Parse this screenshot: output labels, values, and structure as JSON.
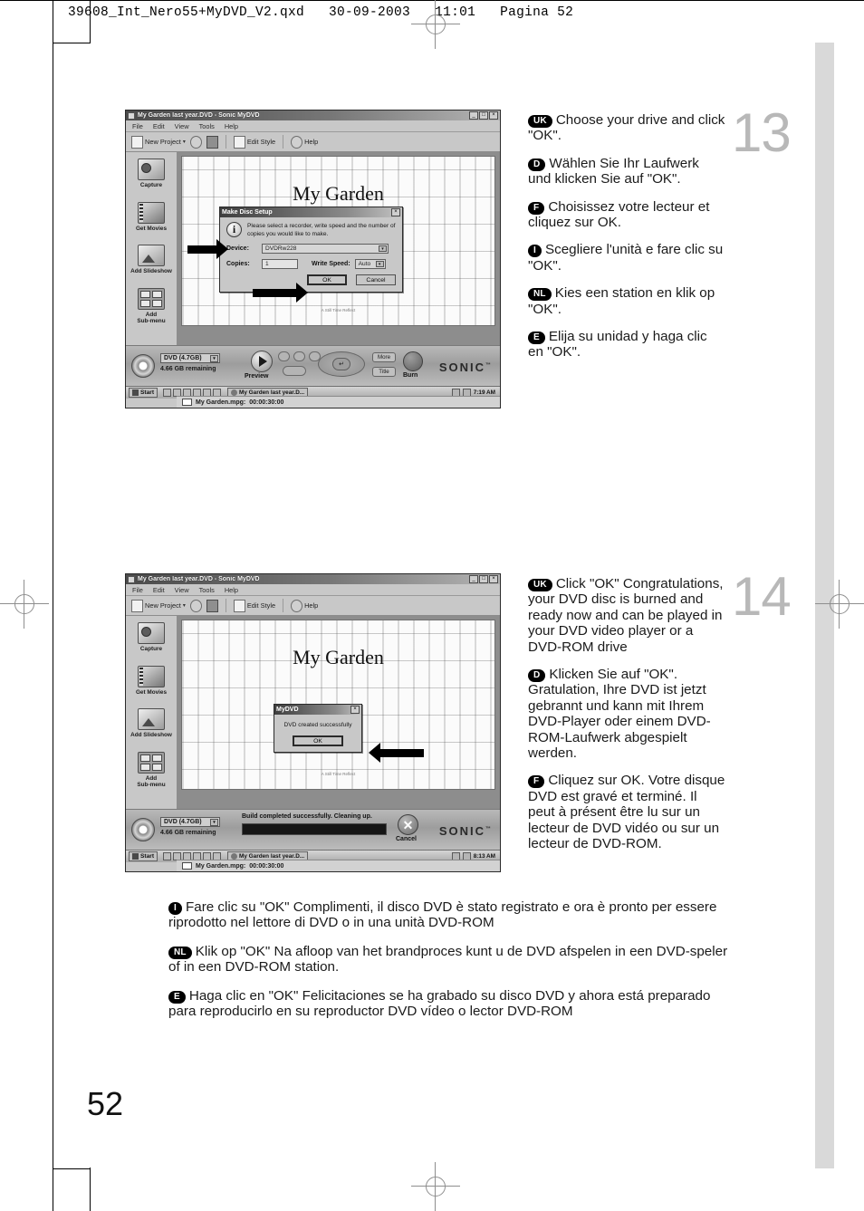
{
  "page": {
    "qxd_header": "39608_Int_Nero55+MyDVD_V2.qxd   30-09-2003   11:01   Pagina 52",
    "page_number": "52"
  },
  "steps": [
    {
      "number": "13"
    },
    {
      "number": "14"
    }
  ],
  "app": {
    "title": "My Garden last year.DVD - Sonic MyDVD",
    "menus": [
      "File",
      "Edit",
      "View",
      "Tools",
      "Help"
    ],
    "toolbar": {
      "new_project": "New Project",
      "caret": "▾",
      "edit_style": "Edit Style",
      "help": "Help"
    },
    "window_buttons": {
      "minimize": "_",
      "maximize": "□",
      "close": "×"
    },
    "sidebar": [
      {
        "label": "Capture",
        "icon": "camcorder-icon"
      },
      {
        "label": "Get Movies",
        "icon": "film-reel-icon"
      },
      {
        "label": "Add Slideshow",
        "icon": "picture-icon"
      },
      {
        "label": "Add\nSub-menu",
        "label_line1": "Add",
        "label_line2": "Sub-menu",
        "icon": "grid-icon"
      }
    ],
    "menu_page": {
      "title": "My Garden",
      "footnote": "A Still Time Reflect"
    },
    "file_bar": {
      "name": "My Garden.mpg:",
      "duration": "00:00:30:00"
    },
    "console": {
      "disc_type": "DVD (4.7GB)",
      "remaining": "4.66 GB remaining",
      "preview": "Preview",
      "more": "More",
      "title_btn": "Title",
      "burn": "Burn",
      "brand": "SONIC",
      "brand_tm": "™",
      "mini_buttons": [
        "❙❙",
        "⏮",
        "⏭"
      ],
      "dpad_enter": "↵"
    },
    "console_build": {
      "status": "Build completed successfully. Cleaning up.",
      "cancel": "Cancel",
      "cancel_glyph": "✕"
    },
    "taskbar": {
      "start": "Start",
      "task": "My Garden last year.D...",
      "time_step13": "7:19 AM",
      "time_step14": "8:13 AM"
    }
  },
  "dialog_setup": {
    "title": "Make Disc Setup",
    "close": "×",
    "message": "Please select a recorder, write speed and the number of copies you would like to make.",
    "info_glyph": "i",
    "device_label": "Device:",
    "device_value": "DVDRw228",
    "copies_label": "Copies:",
    "copies_value": "1",
    "write_speed_label": "Write Speed:",
    "write_speed_value": "Auto",
    "ok": "OK",
    "cancel": "Cancel",
    "dropdown_arrow": "▾"
  },
  "dialog_success": {
    "title": "MyDVD",
    "close": "×",
    "message": "DVD created successfully",
    "ok": "OK"
  },
  "instructions_13": [
    {
      "lang": "UK",
      "text": "Choose your drive and click \"OK\"."
    },
    {
      "lang": "D",
      "text": "Wählen Sie Ihr Laufwerk und klicken Sie auf \"OK\"."
    },
    {
      "lang": "F",
      "text": "Choisissez votre lecteur et cliquez sur OK."
    },
    {
      "lang": "I",
      "text": "Scegliere l'unità e fare clic su \"OK\"."
    },
    {
      "lang": "NL",
      "text": "Kies een station en klik op \"OK\"."
    },
    {
      "lang": "E",
      "text": "Elija su unidad y haga clic en \"OK\"."
    }
  ],
  "instructions_14": [
    {
      "lang": "UK",
      "text": "Click \"OK\" Congratulations, your DVD disc is burned and ready now and can be played in your DVD video player or a DVD-ROM drive"
    },
    {
      "lang": "D",
      "text": "Klicken Sie auf \"OK\". Gratulation, Ihre DVD ist jetzt gebrannt und kann mit Ihrem DVD-Player oder einem DVD-ROM-Laufwerk abgespielt werden."
    },
    {
      "lang": "F",
      "text": "Cliquez sur OK. Votre disque DVD est gravé et terminé. Il peut à présent être lu sur un lecteur de DVD vidéo ou sur un lecteur de DVD-ROM."
    }
  ],
  "instructions_14_bottom": [
    {
      "lang": "I",
      "text": "Fare clic su \"OK\" Complimenti, il disco DVD è stato registrato e ora è pronto per essere riprodotto nel lettore di DVD o in una unità DVD-ROM"
    },
    {
      "lang": "NL",
      "text": "Klik op \"OK\" Na afloop van het brandproces kunt u de DVD afspelen in een DVD-speler of in een DVD-ROM station."
    },
    {
      "lang": "E",
      "text": "Haga clic en \"OK\" Felicitaciones se ha grabado su disco DVD y ahora está preparado para reproducirlo en su reproductor DVD vídeo o  lector DVD-ROM"
    }
  ]
}
